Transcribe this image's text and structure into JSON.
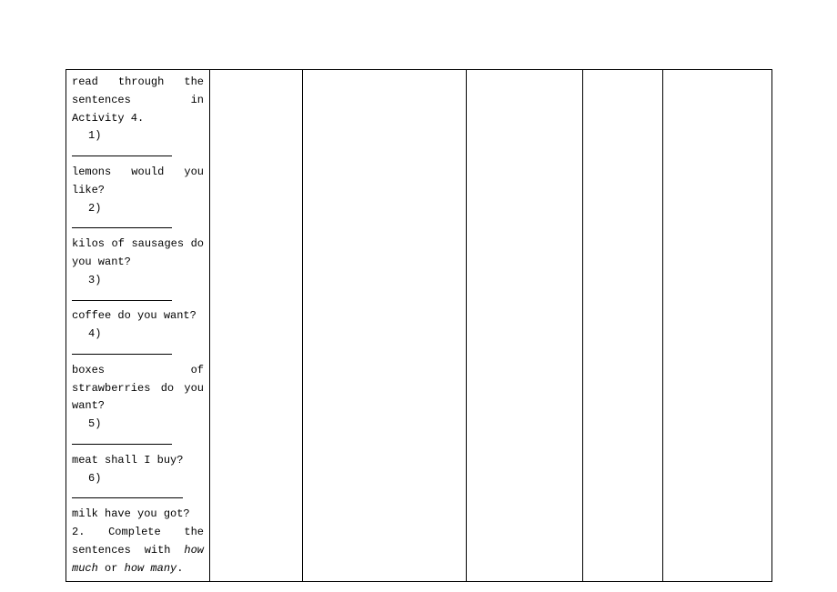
{
  "cell1": {
    "intro_pre": "read through the sentences in Activity 4.",
    "items": [
      {
        "num": "1)",
        "text": " lemons would you like?"
      },
      {
        "num": "2)",
        "text": " kilos of sausages do you want?"
      },
      {
        "num": "3)",
        "text": " coffee do you want?"
      },
      {
        "num": "4)",
        "text": " boxes of strawberries do you want?"
      },
      {
        "num": "5)",
        "text": " meat shall I buy?"
      },
      {
        "num": "6)",
        "text_after": "milk have you got?",
        "inline": true
      }
    ],
    "footer_lead": "2. Complete the sentences with ",
    "footer_it1": "how much",
    "footer_mid": " or ",
    "footer_it2": "how many",
    "footer_end": "."
  }
}
